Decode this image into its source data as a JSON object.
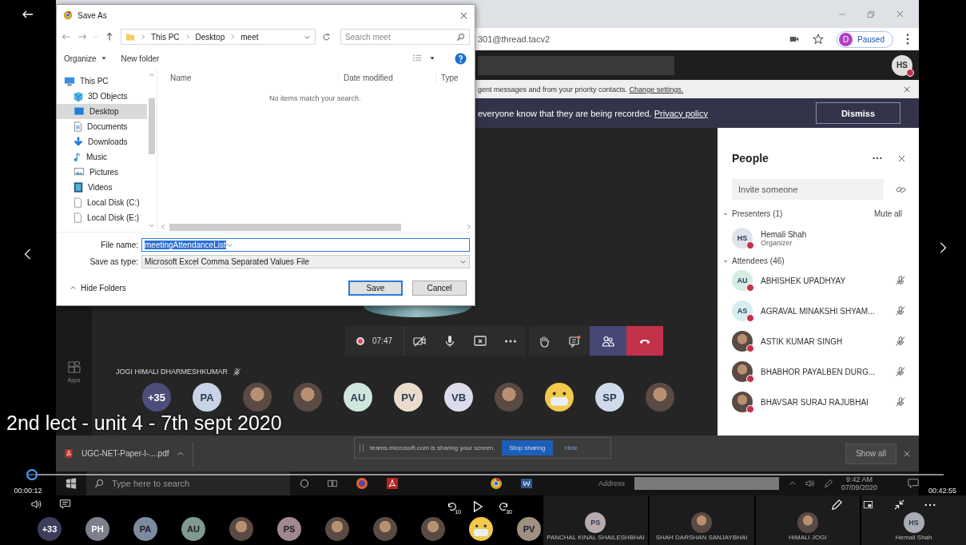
{
  "player": {
    "title": "2nd lect - unit 4 - 7th sept 2020",
    "elapsed": "00:00:12",
    "duration": "00:42:55",
    "level": 0.005,
    "rewind_seconds": "10",
    "forward_seconds": "30"
  },
  "browser": {
    "url": "301@thread.tacv2",
    "profile_initial": "D",
    "profile_status": "Paused",
    "account_initials": "HS"
  },
  "notification": {
    "text": "gent messages and from your priority contacts.",
    "link": "Change settings."
  },
  "recording_banner": {
    "text": "everyone know that they are being recorded.",
    "link": "Privacy policy",
    "button": "Dismiss"
  },
  "save_dialog": {
    "title": "Save As",
    "path": [
      "This PC",
      "Desktop",
      "meet"
    ],
    "search_placeholder": "Search meet",
    "organize": "Organize",
    "new_folder": "New folder",
    "nav": [
      {
        "label": "This PC",
        "kind": "pc",
        "selected": false
      },
      {
        "label": "3D Objects",
        "kind": "cube",
        "selected": false
      },
      {
        "label": "Desktop",
        "kind": "desktop",
        "selected": true
      },
      {
        "label": "Documents",
        "kind": "documents",
        "selected": false
      },
      {
        "label": "Downloads",
        "kind": "downloads",
        "selected": false
      },
      {
        "label": "Music",
        "kind": "music",
        "selected": false
      },
      {
        "label": "Pictures",
        "kind": "pictures",
        "selected": false
      },
      {
        "label": "Videos",
        "kind": "videos",
        "selected": false
      },
      {
        "label": "Local Disk (C:)",
        "kind": "disk",
        "selected": false
      },
      {
        "label": "Local Disk (E:)",
        "kind": "disk",
        "selected": false
      }
    ],
    "columns": [
      "Name",
      "Date modified",
      "Type"
    ],
    "empty_message": "No items match your search.",
    "file_name_label": "File name:",
    "file_name": "meetingAttendanceList",
    "type_label": "Save as type:",
    "file_type": "Microsoft Excel Comma Separated Values File",
    "hide_folders": "Hide Folders",
    "buttons": [
      {
        "label": "Save",
        "default": true
      },
      {
        "label": "Cancel",
        "default": false
      }
    ]
  },
  "meeting": {
    "rail_label": "Apps",
    "timer": "07:47",
    "controls": [
      {
        "kind": "camera",
        "selected": false
      },
      {
        "kind": "mic",
        "selected": false
      },
      {
        "kind": "share",
        "selected": false
      },
      {
        "kind": "more",
        "selected": false
      },
      {
        "kind": "hand",
        "selected": false
      },
      {
        "kind": "chat",
        "selected": false
      },
      {
        "kind": "people",
        "selected": true
      },
      {
        "kind": "hangup",
        "selected": false
      }
    ],
    "speaker": "JOGI HIMALI DHARMESHKUMAR",
    "gallery": [
      {
        "kind": "initials",
        "initials": "+35",
        "color": "#4b4d7a"
      },
      {
        "kind": "initials",
        "initials": "PA",
        "color": "#c8d3e6"
      },
      {
        "kind": "photo"
      },
      {
        "kind": "photo"
      },
      {
        "kind": "initials",
        "initials": "AU",
        "color": "#cfe6dc"
      },
      {
        "kind": "initials",
        "initials": "PV",
        "color": "#eadbcc"
      },
      {
        "kind": "initials",
        "initials": "VB",
        "color": "#dcdcec"
      },
      {
        "kind": "photo"
      },
      {
        "kind": "emoji"
      },
      {
        "kind": "initials",
        "initials": "SP",
        "color": "#cfdbea"
      },
      {
        "kind": "photo"
      }
    ]
  },
  "people_panel": {
    "title": "People",
    "invite_placeholder": "Invite someone",
    "presenters_heading": "Presenters (1)",
    "mute_all": "Mute all",
    "presenters": [
      {
        "name": "Hemali Shah",
        "role": "Organizer",
        "kind": "initials",
        "initials": "HS",
        "color": "#dfe3ea"
      }
    ],
    "attendees_heading": "Attendees (46)",
    "attendees": [
      {
        "name": "ABHISHEK UPADHYAY",
        "kind": "initials",
        "initials": "AU",
        "color": "#d6ede3"
      },
      {
        "name": "AGRAVAL MINAKSHI SHYAM...",
        "kind": "initials",
        "initials": "AS",
        "color": "#d7eef0"
      },
      {
        "name": "ASTIK KUMAR SINGH",
        "kind": "photo"
      },
      {
        "name": "BHABHOR PAYALBEN DURG...",
        "kind": "photo"
      },
      {
        "name": "BHAVSAR SURAJ RAJUBHAI",
        "kind": "photo"
      }
    ]
  },
  "downloads_bar": {
    "file": "UGC-NET-Paper-I-....pdf",
    "show_all": "Show all"
  },
  "share_bar": {
    "text": "teams.microsoft.com is sharing your screen.",
    "stop": "Stop sharing",
    "hide": "Hide"
  },
  "taskbar": {
    "search_placeholder": "Type here to search",
    "address_label": "Address",
    "time": "9:42 AM",
    "date": "07/09/2020"
  },
  "participant_strip": {
    "avatars": [
      {
        "kind": "initials",
        "initials": "+33",
        "color": "#3b3d5a"
      },
      {
        "kind": "initials",
        "initials": "PH",
        "color": "#7c7f8c"
      },
      {
        "kind": "initials",
        "initials": "PA",
        "color": "#7d8ba0"
      },
      {
        "kind": "initials",
        "initials": "AU",
        "color": "#7f9a8e"
      },
      {
        "kind": "photo"
      },
      {
        "kind": "initials",
        "initials": "PS",
        "color": "#a08890"
      },
      {
        "kind": "photo"
      },
      {
        "kind": "photo"
      },
      {
        "kind": "photo"
      },
      {
        "kind": "emoji"
      },
      {
        "kind": "initials",
        "initials": "PV",
        "color": "#a09080"
      }
    ],
    "tiles": [
      {
        "kind": "initials",
        "initials": "PS",
        "color": "#b9a9b0",
        "name": "PANCHAL KINAL SHAILESHBHAI"
      },
      {
        "kind": "photo",
        "name": "SHAH DARSHAN SANJAYBHAI"
      },
      {
        "kind": "photo",
        "name": "HIMALI JOGI"
      },
      {
        "kind": "initials",
        "initials": "HS",
        "color": "#a9acb4",
        "name": "Hemali Shah"
      }
    ]
  }
}
